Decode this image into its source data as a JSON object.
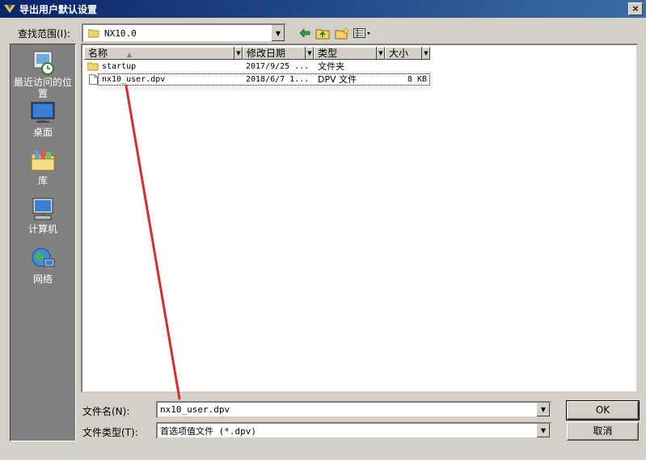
{
  "window": {
    "title": "导出用户默认设置",
    "close_label": "×"
  },
  "lookin": {
    "label": "查找范围(I):",
    "value": "NX10.0"
  },
  "places": [
    {
      "label": "最近访问的位置",
      "icon": "recent-places-icon"
    },
    {
      "label": "桌面",
      "icon": "desktop-icon"
    },
    {
      "label": "库",
      "icon": "libraries-icon"
    },
    {
      "label": "计算机",
      "icon": "computer-icon"
    },
    {
      "label": "网络",
      "icon": "network-icon"
    }
  ],
  "columns": {
    "name": "名称",
    "date": "修改日期",
    "type": "类型",
    "size": "大小"
  },
  "files": [
    {
      "name": "startup",
      "date": "2017/9/25 ...",
      "type": "文件夹",
      "size": "",
      "icon": "folder-icon"
    },
    {
      "name": "nx10_user.dpv",
      "date": "2018/6/7 1...",
      "type": "DPV 文件",
      "size": "8 KB",
      "icon": "file-icon"
    }
  ],
  "filename": {
    "label": "文件名(N):",
    "value": "nx10_user.dpv"
  },
  "filetype": {
    "label": "文件类型(T):",
    "value": "首选项值文件 (*.dpv)"
  },
  "buttons": {
    "ok": "OK",
    "cancel": "取消"
  },
  "colors": {
    "titlebar": "#0a246a",
    "annotation_arrow": "#d32f2f",
    "places_bg": "#808080"
  }
}
